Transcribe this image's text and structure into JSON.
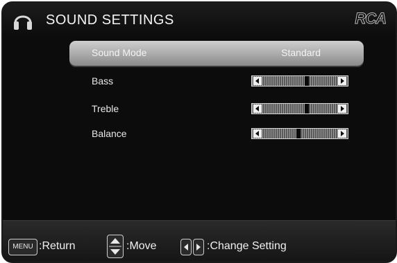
{
  "header": {
    "title": "SOUND SETTINGS",
    "brand": "RCA",
    "icon": "headphones-icon"
  },
  "menu": [
    {
      "label": "Sound Mode",
      "value": "Standard",
      "selected": true
    },
    {
      "label": "Bass",
      "level": 0.6
    },
    {
      "label": "Treble",
      "level": 0.6
    },
    {
      "label": "Balance",
      "level": 0.48
    }
  ],
  "footer": {
    "menu_key": "MENU",
    "return_label": ":Return",
    "move_label": ":Move",
    "change_label": ":Change Setting"
  },
  "colors": {
    "background": "#0c0c0c",
    "highlight": "#b0b0b0",
    "text": "#f4f4f4"
  }
}
